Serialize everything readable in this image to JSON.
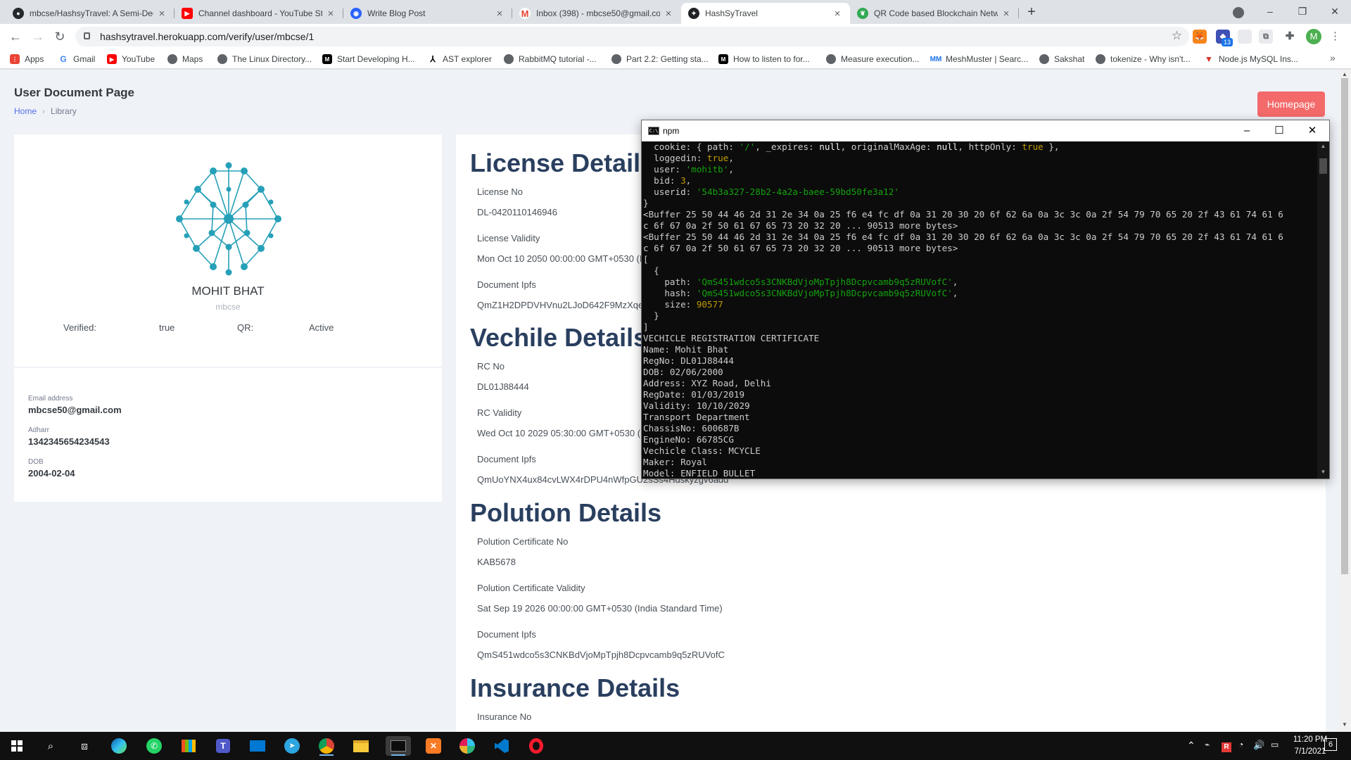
{
  "browser": {
    "tabs": [
      {
        "title": "mbcse/HashsyTravel: A Semi-Dec",
        "icon": "github-icon",
        "color": "#24292e"
      },
      {
        "title": "Channel dashboard - YouTube St",
        "icon": "youtube-icon",
        "color": "#ff0000"
      },
      {
        "title": "Write Blog Post",
        "icon": "hashnode-icon",
        "color": "#2962ff"
      },
      {
        "title": "Inbox (398) - mbcse50@gmail.co",
        "icon": "gmail-icon",
        "color": "#ea4335"
      },
      {
        "title": "HashSyTravel",
        "icon": "hashsy-icon",
        "color": "#202124"
      },
      {
        "title": "QR Code based Blockchain Netw",
        "icon": "leaf-icon",
        "color": "#34a853"
      }
    ],
    "url": "hashsytravel.herokuapp.com/verify/user/mbcse/1",
    "profile_initial": "M",
    "metamask_badge": "13",
    "bookmarks": [
      {
        "label": "Apps",
        "color": "#ea4335"
      },
      {
        "label": "Gmail",
        "color": "#4285f4"
      },
      {
        "label": "YouTube",
        "color": "#ff0000"
      },
      {
        "label": "Maps",
        "color": "#5f6368"
      },
      {
        "label": "The Linux Directory...",
        "color": "#5f6368"
      },
      {
        "label": "Start Developing H...",
        "color": "#000000"
      },
      {
        "label": "AST explorer",
        "color": "#000000"
      },
      {
        "label": "RabbitMQ tutorial -...",
        "color": "#5f6368"
      },
      {
        "label": "Part 2.2: Getting sta...",
        "color": "#5f6368"
      },
      {
        "label": "How to listen to for...",
        "color": "#000000"
      },
      {
        "label": "Measure execution...",
        "color": "#5f6368"
      },
      {
        "label": "MeshMuster | Searc...",
        "color": "#1a73e8"
      },
      {
        "label": "Sakshat",
        "color": "#5f6368"
      },
      {
        "label": "tokenize - Why isn't...",
        "color": "#5f6368"
      },
      {
        "label": "Node.js MySQL Ins...",
        "color": "#d93025"
      }
    ],
    "bookmarks_overflow": "»"
  },
  "page": {
    "title": "User Document Page",
    "breadcrumb": {
      "home": "Home",
      "current": "Library"
    },
    "homepage_button": "Homepage",
    "profile": {
      "name": "MOHIT BHAT",
      "username": "mbcse",
      "verified_label": "Verified:",
      "verified_value": "true",
      "qr_label": "QR:",
      "qr_value": "Active"
    },
    "contact": {
      "email_label": "Email address",
      "email": "mbcse50@gmail.com",
      "aadhar_label": "Adharr",
      "aadhar": "1342345654234543",
      "dob_label": "DOB",
      "dob": "2004-02-04"
    },
    "license": {
      "heading": "License Details",
      "no_label": "License No",
      "no": "DL-0420110146946",
      "validity_label": "License Validity",
      "validity": "Mon Oct 10 2050 00:00:00 GMT+0530 (India Standard Time)",
      "ipfs_label": "Document Ipfs",
      "ipfs": "QmZ1H2DPDVHVnu2LJoD642F9MzXqeR8Xn8aQm3pxSRHhZb"
    },
    "vehicle": {
      "heading": "Vechile Details",
      "no_label": "RC No",
      "no": "DL01J88444",
      "validity_label": "RC Validity",
      "validity": "Wed Oct 10 2029 05:30:00 GMT+0530 (India Standard Time)",
      "ipfs_label": "Document Ipfs",
      "ipfs": "QmUoYNX4ux84cvLWX4rDPU4nWfpGU2sSs4Hdskyzgv6add"
    },
    "pollution": {
      "heading": "Polution Details",
      "no_label": "Polution Certificate No",
      "no": "KAB5678",
      "validity_label": "Polution Certificate Validity",
      "validity": "Sat Sep 19 2026 00:00:00 GMT+0530 (India Standard Time)",
      "ipfs_label": "Document Ipfs",
      "ipfs": "QmS451wdco5s3CNKBdVjoMpTpjh8Dcpvcamb9q5zRUVofC"
    },
    "insurance": {
      "heading": "Insurance Details",
      "no_label": "Insurance No"
    }
  },
  "console": {
    "title": "npm",
    "lines": [
      [
        {
          "t": "  cookie: { path: "
        },
        {
          "t": "'/'",
          "c": "g"
        },
        {
          "t": ", _expires: "
        },
        {
          "t": "null",
          "c": "w"
        },
        {
          "t": ", originalMaxAge: "
        },
        {
          "t": "null",
          "c": "w"
        },
        {
          "t": ", httpOnly: "
        },
        {
          "t": "true",
          "c": "y"
        },
        {
          "t": " },"
        }
      ],
      [
        {
          "t": "  loggedin: "
        },
        {
          "t": "true",
          "c": "y"
        },
        {
          "t": ","
        }
      ],
      [
        {
          "t": "  user: "
        },
        {
          "t": "'mohitb'",
          "c": "g"
        },
        {
          "t": ","
        }
      ],
      [
        {
          "t": "  bid: "
        },
        {
          "t": "3",
          "c": "y"
        },
        {
          "t": ","
        }
      ],
      [
        {
          "t": "  userid: "
        },
        {
          "t": "'54b3a327-28b2-4a2a-baee-59bd50fe3a12'",
          "c": "g"
        }
      ],
      [
        {
          "t": "}"
        }
      ],
      [
        {
          "t": "<Buffer 25 50 44 46 2d 31 2e 34 0a 25 f6 e4 fc df 0a 31 20 30 20 6f 62 6a 0a 3c 3c 0a 2f 54 79 70 65 20 2f 43 61 74 61 6"
        }
      ],
      [
        {
          "t": "c 6f 67 0a 2f 50 61 67 65 73 20 32 20 ... 90513 more bytes>"
        }
      ],
      [
        {
          "t": "<Buffer 25 50 44 46 2d 31 2e 34 0a 25 f6 e4 fc df 0a 31 20 30 20 6f 62 6a 0a 3c 3c 0a 2f 54 79 70 65 20 2f 43 61 74 61 6"
        }
      ],
      [
        {
          "t": "c 6f 67 0a 2f 50 61 67 65 73 20 32 20 ... 90513 more bytes>"
        }
      ],
      [
        {
          "t": "["
        }
      ],
      [
        {
          "t": "  {"
        }
      ],
      [
        {
          "t": "    path: "
        },
        {
          "t": "'QmS451wdco5s3CNKBdVjoMpTpjh8Dcpvcamb9q5zRUVofC'",
          "c": "g"
        },
        {
          "t": ","
        }
      ],
      [
        {
          "t": "    hash: "
        },
        {
          "t": "'QmS451wdco5s3CNKBdVjoMpTpjh8Dcpvcamb9q5zRUVofC'",
          "c": "g"
        },
        {
          "t": ","
        }
      ],
      [
        {
          "t": "    size: "
        },
        {
          "t": "90577",
          "c": "y"
        }
      ],
      [
        {
          "t": "  }"
        }
      ],
      [
        {
          "t": "]"
        }
      ],
      [
        {
          "t": "VECHICLE REGISTRATION CERTIFICATE"
        }
      ],
      [
        {
          "t": "Name: Mohit Bhat"
        }
      ],
      [
        {
          "t": "RegNo: DL01J88444"
        }
      ],
      [
        {
          "t": "DOB: 02/06/2000"
        }
      ],
      [
        {
          "t": "Address: XYZ Road, Delhi"
        }
      ],
      [
        {
          "t": "RegDate: 01/03/2019"
        }
      ],
      [
        {
          "t": "Validity: 10/10/2029"
        }
      ],
      [
        {
          "t": "Transport Department"
        }
      ],
      [
        {
          "t": "ChassisNo: 600687B"
        }
      ],
      [
        {
          "t": "EngineNo: 66785CG"
        }
      ],
      [
        {
          "t": "Vechicle Class: MCYCLE"
        }
      ],
      [
        {
          "t": "Maker: Royal"
        }
      ],
      [
        {
          "t": "Model: ENFIELD BULLET"
        }
      ]
    ]
  },
  "taskbar": {
    "time": "11:20 PM",
    "date": "7/1/2021",
    "notification_count": "6"
  }
}
